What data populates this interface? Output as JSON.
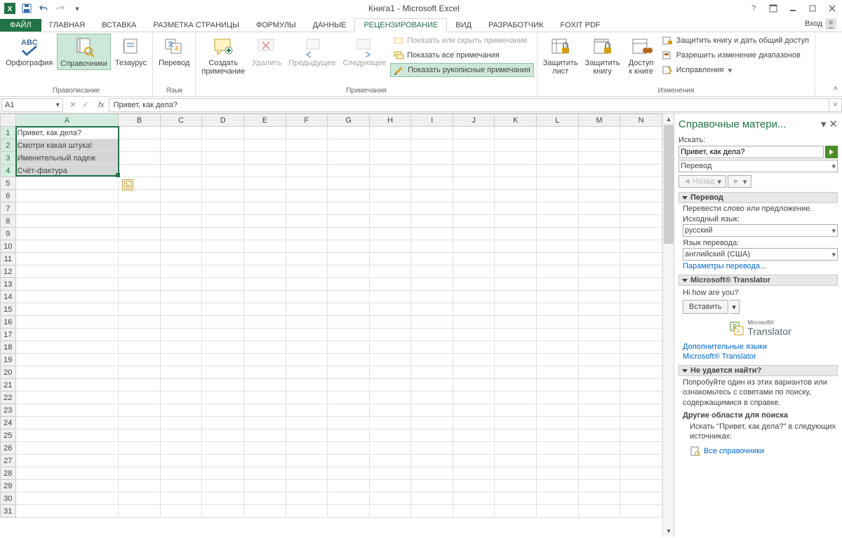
{
  "titlebar": {
    "title": "Книга1 - Microsoft Excel",
    "login": "Вход"
  },
  "tabs": {
    "file": "ФАЙЛ",
    "home": "ГЛАВНАЯ",
    "insert": "ВСТАВКА",
    "page_layout": "РАЗМЕТКА СТРАНИЦЫ",
    "formulas": "ФОРМУЛЫ",
    "data": "ДАННЫЕ",
    "review": "РЕЦЕНЗИРОВАНИЕ",
    "view": "ВИД",
    "developer": "РАЗРАБОТЧИК",
    "foxit": "FOXIT PDF"
  },
  "ribbon": {
    "proofing": {
      "label": "Правописание",
      "spelling": "Орфография",
      "research": "Справочники",
      "thesaurus": "Тезаурус"
    },
    "language": {
      "label": "Язык",
      "translate": "Перевод"
    },
    "comments": {
      "label": "Примечания",
      "new": "Создать\nпримечание",
      "delete": "Удалить",
      "previous": "Предыдущее",
      "next": "Следующее",
      "show_hide": "Показать или скрыть примечание",
      "show_all": "Показать все примечания",
      "show_ink": "Показать рукописные примечания"
    },
    "changes": {
      "label": "Изменения",
      "protect_sheet": "Защитить\nлист",
      "protect_book": "Защитить\nкнигу",
      "share_book": "Доступ\nк книге",
      "protect_share": "Защитить книгу и дать общий доступ",
      "allow_ranges": "Разрешить изменение диапазонов",
      "track": "Исправления"
    }
  },
  "name_box": "A1",
  "formula_value": "Привет, как дела?",
  "columns": [
    "A",
    "B",
    "C",
    "D",
    "E",
    "F",
    "G",
    "H",
    "I",
    "J",
    "K",
    "L",
    "M",
    "N"
  ],
  "cells": {
    "a1": "Привет, как дела?",
    "a2": "Смотри какая штука!",
    "a3": "Именительный падеж",
    "a4": "Счёт-фактура"
  },
  "taskpane": {
    "title": "Справочные матери...",
    "search_label": "Искать:",
    "search_value": "Привет, как дела?",
    "category": "Перевод",
    "back": "Назад",
    "section_translate": "Перевод",
    "translate_hint": "Перевести слово или предложение.",
    "source_label": "Исходный язык:",
    "source_lang": "русский",
    "target_label": "Язык перевода:",
    "target_lang": "английский (США)",
    "options_link": "Параметры перевода...",
    "ms_translator_section": "Microsoft® Translator",
    "result": "Hi how are you?",
    "insert": "Вставить",
    "logo_small": "Microsoft®",
    "logo_big": "Translator",
    "more_langs": "Дополнительные языки",
    "ms_link": "Microsoft® Translator",
    "notfound_section": "Не удается найти?",
    "notfound_text": "Попробуйте один из этих вариантов или ознакомьтесь с советами по поиску, содержащимися в справке.",
    "other_areas": "Другие области для поиска",
    "search_in": "Искать \"Привет, как дела?\" в следующих источниках:",
    "all_refs": "Все справочники"
  }
}
